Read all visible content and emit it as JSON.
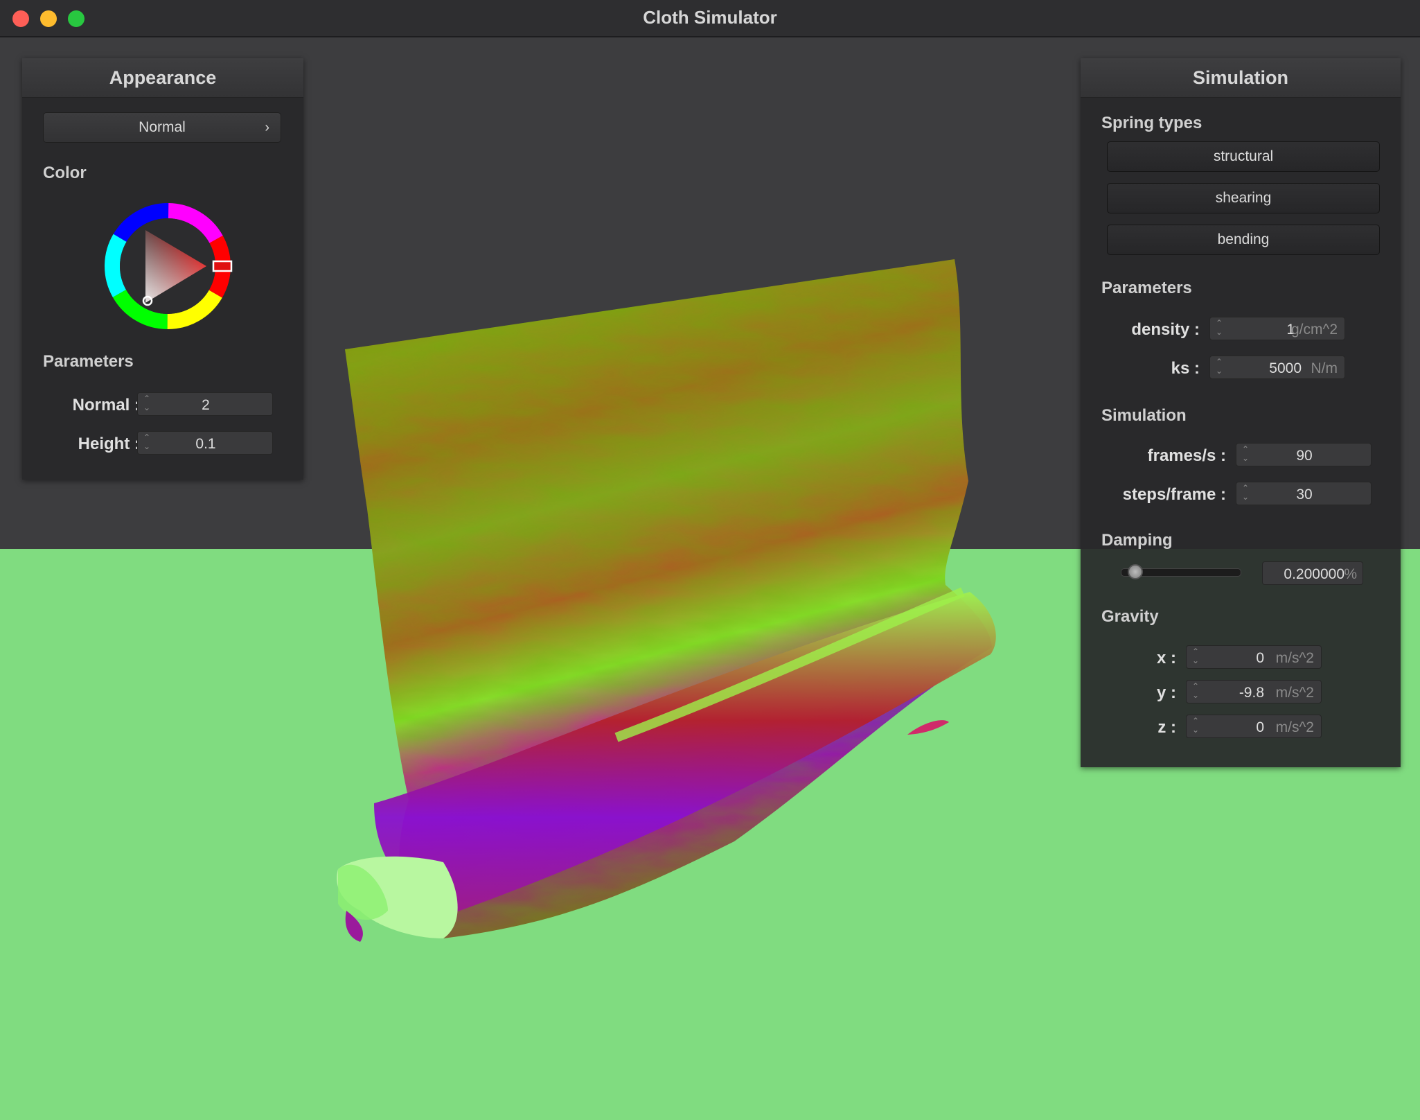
{
  "window": {
    "title": "Cloth Simulator"
  },
  "colors": {
    "floor": "#80dc80",
    "background": "#3d3d3f",
    "panel": "#28282a"
  },
  "appearance": {
    "title": "Appearance",
    "shader_select": "Normal",
    "color_label": "Color",
    "params_label": "Parameters",
    "normal_label": "Normal :",
    "normal_value": "2",
    "height_label": "Height :",
    "height_value": "0.1"
  },
  "simulation": {
    "title": "Simulation",
    "spring_types_label": "Spring types",
    "spring_types": [
      "structural",
      "shearing",
      "bending"
    ],
    "params_label": "Parameters",
    "density_label": "density :",
    "density_value": "1",
    "density_unit": "g/cm^2",
    "ks_label": "ks :",
    "ks_value": "5000",
    "ks_unit": "N/m",
    "sim_label": "Simulation",
    "fps_label": "frames/s :",
    "fps_value": "90",
    "steps_label": "steps/frame :",
    "steps_value": "30",
    "damping_label": "Damping",
    "damping_value": "0.200000",
    "damping_unit": "%",
    "damping_fraction": 0.2,
    "gravity_label": "Gravity",
    "gx_label": "x :",
    "gx_value": "0",
    "gy_label": "y :",
    "gy_value": "-9.8",
    "gz_label": "z :",
    "gz_value": "0",
    "g_unit": "m/s^2"
  }
}
